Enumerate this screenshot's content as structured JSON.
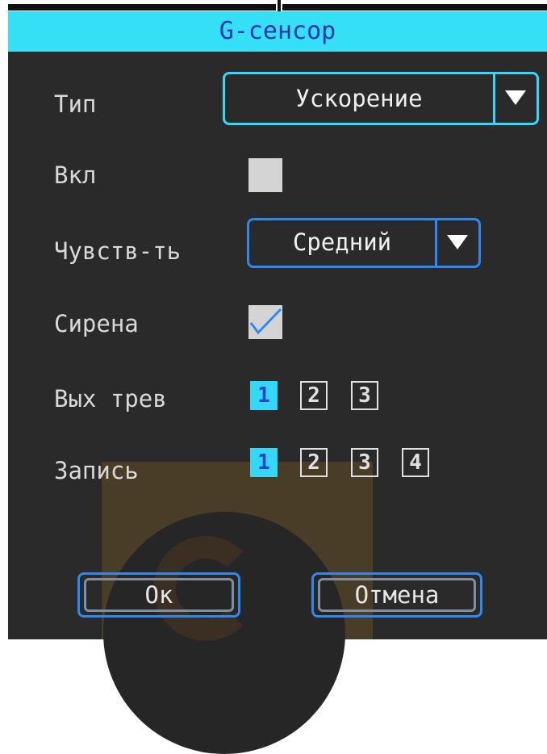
{
  "dialog": {
    "title": "G-сенсор"
  },
  "type": {
    "label": "Тип",
    "value": "Ускорение"
  },
  "enable": {
    "label": "Вкл",
    "checked": false
  },
  "sensitivity": {
    "label": "Чувств-ть",
    "value": "Средний"
  },
  "siren": {
    "label": "Сирена",
    "checked": true
  },
  "alarm_out": {
    "label": "Вых трев",
    "options": [
      "1",
      "2",
      "3"
    ],
    "selected": [
      "1"
    ]
  },
  "record": {
    "label": "Запись",
    "options": [
      "1",
      "2",
      "3",
      "4"
    ],
    "selected": [
      "1"
    ]
  },
  "buttons": {
    "ok": "Ок",
    "cancel": "Отмена"
  },
  "colors": {
    "title_bg": "#35e0f7",
    "dialog_bg": "#2a2a2a",
    "accent_blue": "#2f87f2",
    "accent_cyan": "#38d6f4",
    "active_num_bg": "#35d6f6"
  }
}
